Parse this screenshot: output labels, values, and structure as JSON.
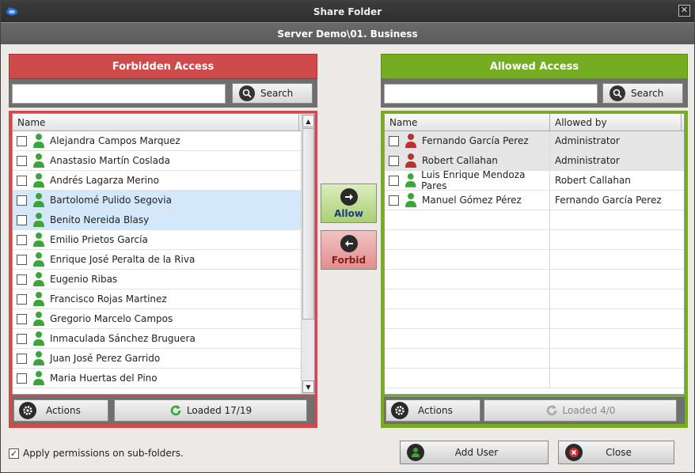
{
  "window": {
    "title": "Share Folder",
    "subtitle": "Server Demo\\01. Business",
    "close_glyph": "✕"
  },
  "forbidden": {
    "title": "Forbidden Access",
    "search_placeholder": "",
    "search_label": "Search",
    "col_name": "Name",
    "rows": [
      {
        "name": "Alejandra Campos Marquez",
        "selected": false
      },
      {
        "name": "Anastasio Martín Coslada",
        "selected": false
      },
      {
        "name": "Andrés Lagarza Merino",
        "selected": false
      },
      {
        "name": "Bartolomé Pulido Segovia",
        "selected": true
      },
      {
        "name": "Benito Nereida Blasy",
        "selected": true
      },
      {
        "name": "Emilio Prietos García",
        "selected": false
      },
      {
        "name": "Enrique José Peralta de la Riva",
        "selected": false
      },
      {
        "name": "Eugenio Ribas",
        "selected": false
      },
      {
        "name": "Francisco Rojas Martinez",
        "selected": false
      },
      {
        "name": "Gregorio Marcelo Campos",
        "selected": false
      },
      {
        "name": "Inmaculada Sánchez Bruguera",
        "selected": false
      },
      {
        "name": "Juan José Perez Garrido",
        "selected": false
      },
      {
        "name": "Maria Huertas del Pino",
        "selected": false
      }
    ],
    "actions_label": "Actions",
    "loaded_label": "Loaded 17/19"
  },
  "allowed": {
    "title": "Allowed Access",
    "search_placeholder": "",
    "search_label": "Search",
    "col_name": "Name",
    "col_allowed_by": "Allowed by",
    "rows": [
      {
        "name": "Fernando García Perez",
        "allowed_by": "Administrator",
        "icon": "user-red",
        "grey": true
      },
      {
        "name": "Robert Callahan",
        "allowed_by": "Administrator",
        "icon": "user-red",
        "grey": true
      },
      {
        "name": "Luis Enrique Mendoza Pares",
        "allowed_by": "Robert Callahan",
        "icon": "user-green",
        "grey": false
      },
      {
        "name": "Manuel Gómez Pérez",
        "allowed_by": "Fernando García Perez",
        "icon": "user-green",
        "grey": false
      }
    ],
    "empty_rows": 9,
    "actions_label": "Actions",
    "loaded_label": "Loaded 4/0"
  },
  "middle": {
    "allow_label": "Allow",
    "forbid_label": "Forbid"
  },
  "bottom": {
    "apply_label": "Apply permissions on sub-folders.",
    "apply_checked": true,
    "add_user_label": "Add User",
    "close_label": "Close"
  },
  "colors": {
    "forbidden_accent": "#cf4a4a",
    "allowed_accent": "#74ad21",
    "user_green": "#3ba53b",
    "user_red": "#b83232",
    "selection": "#d3e8fa"
  }
}
